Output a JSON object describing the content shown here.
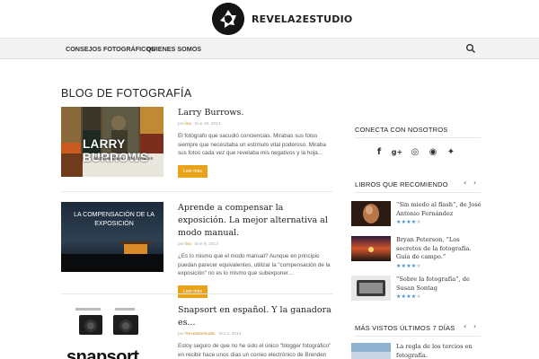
{
  "header": {
    "logo_text": "REVELA2ESTUDIO"
  },
  "nav": {
    "items": [
      {
        "label": "CONSEJOS FOTOGRÁFICOS"
      },
      {
        "label": "QUIENES SOMOS"
      }
    ],
    "search_icon": "search-icon"
  },
  "main": {
    "title": "BLOG DE FOTOGRAFÍA",
    "posts": [
      {
        "title": "Larry Burrows.",
        "meta_prefix": "por ",
        "author": "lira",
        "date": " · Ene 28, 2013",
        "excerpt": "El fotógrafo que sacudió conciencias. Mirabas sus fotos siempre que necesitaba un estímulo vital poderoso. Miraba sus fotos cada vez que revelaba mis negativos y la hoja...",
        "button": "Leer más",
        "thumb_caption": "LARRY BURROWS",
        "thumb_subcaption": "Marines Blues · the Invasion"
      },
      {
        "title": "Aprende a compensar la exposición. La mejor alternativa al modo manual.",
        "meta_prefix": "por ",
        "author": "lira",
        "date": " · Ene 9, 2013",
        "excerpt": "¿Es lo mismo que el modo manual? Aunque en principio puedan parecer equivalentes, utilizar la \"compensación de la exposición\" no es lo mismo que subexponer...",
        "button": "Leer más",
        "thumb_caption": "LA COMPENSACIÓN DE LA EXPOSICIÓN"
      },
      {
        "title": "Snapsort en español. Y la ganadora es...",
        "meta_prefix": "por ",
        "author": "Revela2estudio",
        "date": " · Oct 2, 2013",
        "excerpt": "Estoy seguro de que no he sido el único \"blogger fotográfico\" en recibir hace unos días un correo electrónico de Brenden Sherratt. Sea como sea,...",
        "thumb_caption": "snapsort"
      }
    ]
  },
  "sidebar": {
    "connect_heading": "CONECTA CON NOSOTROS",
    "social_icons": [
      "facebook-icon",
      "google-plus-icon",
      "instagram-icon",
      "rss-icon",
      "twitter-icon"
    ],
    "social_glyphs": [
      "f",
      "g+",
      "◎",
      "◉",
      "✦"
    ],
    "books_heading": "LIBROS QUE RECOMIENDO",
    "nav_prev": "‹",
    "nav_next": "›",
    "books": [
      {
        "title": "“Sin miedo al flash”, de José Antonio Fernández",
        "rating": 4
      },
      {
        "title": "Bryan Peterson, “Los secretos de la fotografía. Guía de campo.”",
        "rating": 4
      },
      {
        "title": "“Sobre la fotografía”, de Susan Sontag",
        "rating": 4
      }
    ],
    "popular_heading": "MÁS VISTOS ÚLTIMOS 7 DÍAS",
    "popular": [
      {
        "title": "La regla de los tercios en fotografía."
      }
    ],
    "star_full": "★",
    "colors": {
      "accent": "#e8a31b",
      "star": "#3f8fd2",
      "author": "#d28a1e"
    }
  }
}
